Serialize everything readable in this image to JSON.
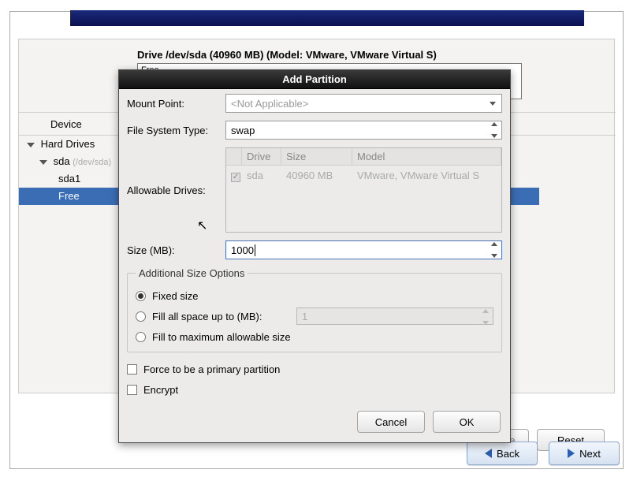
{
  "drive_label": "Drive /dev/sda (40960 MB) (Model: VMware, VMware Virtual S)",
  "drive_box_text": "Free",
  "tree": {
    "header": "Device",
    "root": "Hard Drives",
    "disk": "sda",
    "disk_path": "(/dev/sda)",
    "part1": "sda1",
    "free": "Free"
  },
  "dialog": {
    "title": "Add Partition",
    "mount_point_label": "Mount Point:",
    "mount_point_value": "<Not Applicable>",
    "fs_type_label": "File System Type:",
    "fs_type_value": "swap",
    "allowable_label": "Allowable Drives:",
    "drives_head": {
      "chk": "",
      "drive": "Drive",
      "size": "Size",
      "model": "Model"
    },
    "drives_row": {
      "drive": "sda",
      "size": "40960 MB",
      "model": "VMware, VMware Virtual S"
    },
    "size_label": "Size (MB):",
    "size_value": "1000",
    "size_options_legend": "Additional Size Options",
    "opt_fixed": "Fixed size",
    "opt_fill_up": "Fill all space up to (MB):",
    "opt_fill_up_value": "1",
    "opt_fill_max": "Fill to maximum allowable size",
    "force_primary": "Force to be a primary partition",
    "encrypt": "Encrypt",
    "cancel": "Cancel",
    "ok": "OK"
  },
  "buttons": {
    "delete": "lete",
    "reset": "Reset",
    "back": "Back",
    "next": "Next"
  }
}
